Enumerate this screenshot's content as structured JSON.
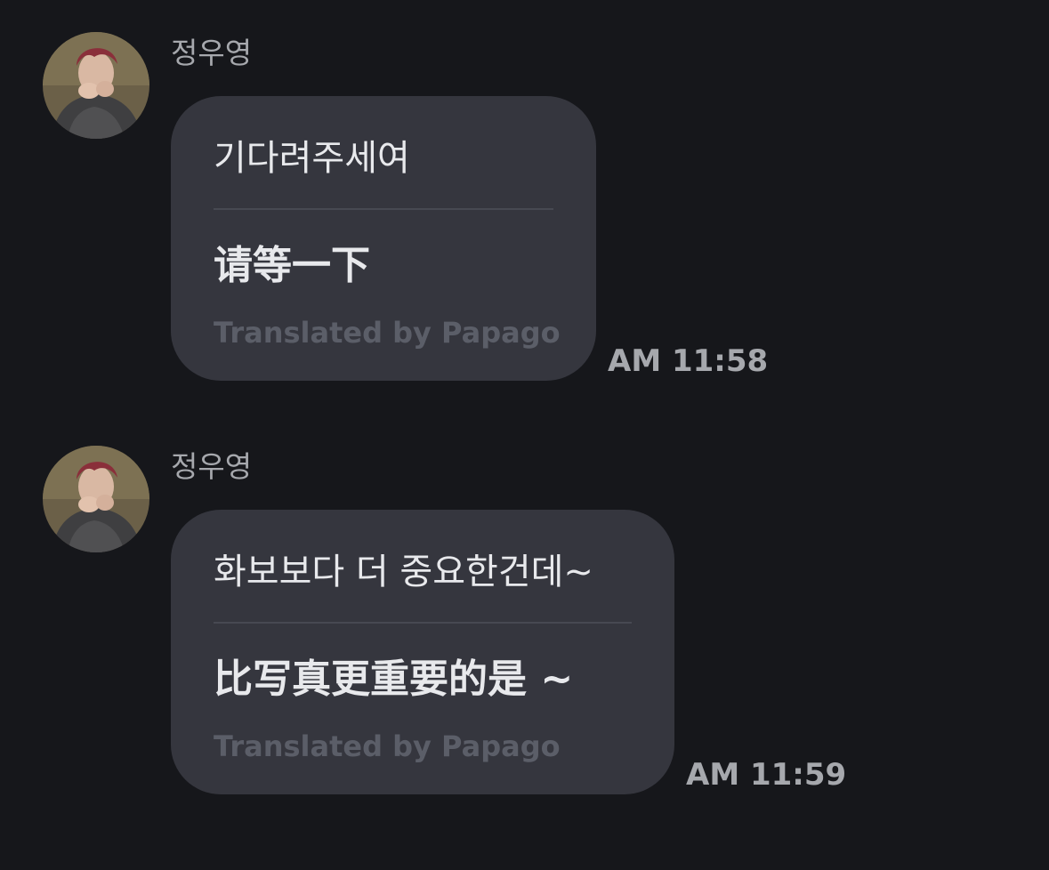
{
  "messages": [
    {
      "sender": "정우영",
      "original": "기다려주세여",
      "translation": "请等一下",
      "credit": "Translated by Papago",
      "time": "AM 11:58"
    },
    {
      "sender": "정우영",
      "original": "화보보다 더 중요한건데~",
      "translation": "比写真更重要的是 ~",
      "credit": "Translated by Papago",
      "time": "AM 11:59"
    }
  ],
  "colors": {
    "background": "#16171b",
    "bubble": "#35363e",
    "text_primary": "#e8e9ec",
    "text_secondary": "#a6a8ad",
    "credit": "#5b5e68"
  }
}
